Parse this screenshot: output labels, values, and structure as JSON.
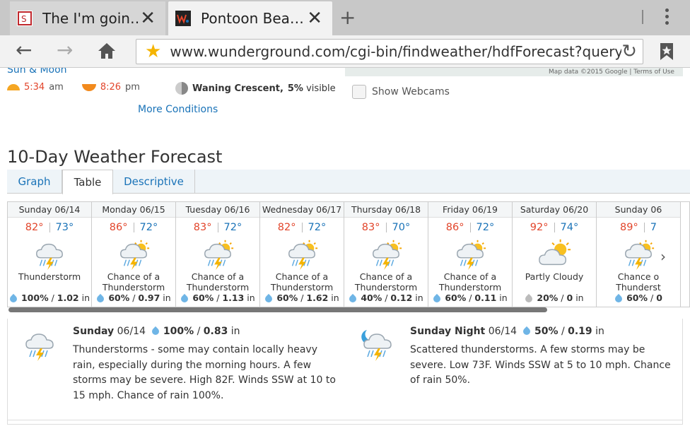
{
  "browser": {
    "tabs": [
      {
        "title": "The I'm goin…",
        "favicon": "site-favicon",
        "close": "✕"
      },
      {
        "title": "Pontoon Bea…",
        "favicon": "wunderground-favicon",
        "close": "✕"
      }
    ],
    "new_tab": "+",
    "url": "www.wunderground.com/cgi-bin/findweather/hdfForecast?query=po"
  },
  "page": {
    "sun_moon_label": "Sun & Moon",
    "sunrise": "5:34",
    "sunrise_suffix": "am",
    "sunset": "8:26",
    "sunset_suffix": "pm",
    "moon_phase": "Waning Crescent,",
    "moon_pct": "5%",
    "moon_suffix": "visible",
    "map_credit": "Map data ©2015 Google  |  Terms of Use",
    "webcams_label": "Show Webcams",
    "more_conditions": "More Conditions",
    "forecast_title": "10-Day Weather Forecast",
    "tabs": [
      "Graph",
      "Table",
      "Descriptive"
    ],
    "days": [
      {
        "name": "Sunday 06/14",
        "hi": "82°",
        "lo": "73°",
        "cond1": "Thunderstorm",
        "cond2": "",
        "pct": "100%",
        "amt": "1.02",
        "unit": "in",
        "icon": "thunderstorm-icon"
      },
      {
        "name": "Monday 06/15",
        "hi": "86°",
        "lo": "72°",
        "cond1": "Chance of a",
        "cond2": "Thunderstorm",
        "pct": "60%",
        "amt": "0.97",
        "unit": "in",
        "icon": "chance-tstorm-icon"
      },
      {
        "name": "Tuesday 06/16",
        "hi": "83°",
        "lo": "72°",
        "cond1": "Chance of a",
        "cond2": "Thunderstorm",
        "pct": "60%",
        "amt": "1.13",
        "unit": "in",
        "icon": "chance-tstorm-icon"
      },
      {
        "name": "Wednesday 06/17",
        "hi": "82°",
        "lo": "72°",
        "cond1": "Chance of a",
        "cond2": "Thunderstorm",
        "pct": "60%",
        "amt": "1.62",
        "unit": "in",
        "icon": "chance-tstorm-icon"
      },
      {
        "name": "Thursday 06/18",
        "hi": "83°",
        "lo": "70°",
        "cond1": "Chance of a",
        "cond2": "Thunderstorm",
        "pct": "40%",
        "amt": "0.12",
        "unit": "in",
        "icon": "chance-tstorm-icon"
      },
      {
        "name": "Friday 06/19",
        "hi": "86°",
        "lo": "72°",
        "cond1": "Chance of a",
        "cond2": "Thunderstorm",
        "pct": "60%",
        "amt": "0.11",
        "unit": "in",
        "icon": "chance-tstorm-icon"
      },
      {
        "name": "Saturday 06/20",
        "hi": "92°",
        "lo": "74°",
        "cond1": "Partly Cloudy",
        "cond2": "",
        "pct": "20%",
        "amt": "0",
        "unit": "in",
        "icon": "partly-cloudy-icon"
      },
      {
        "name": "Sunday 06",
        "hi": "89°",
        "lo": "7",
        "cond1": "Chance o",
        "cond2": "Thunderst",
        "pct": "60%",
        "amt": "0",
        "unit": "",
        "icon": "chance-tstorm-icon"
      }
    ],
    "details": [
      {
        "day": "Sunday",
        "date": "06/14",
        "pct": "100%",
        "amt": "0.83",
        "unit": "in",
        "text": "Thunderstorms - some may contain locally heavy rain, especially during the morning hours. A few storms may be severe. High 82F. Winds SSW at 10 to 15 mph. Chance of rain 100%.",
        "icon": "thunderstorm-icon"
      },
      {
        "day": "Sunday Night",
        "date": "06/14",
        "pct": "50%",
        "amt": "0.19",
        "unit": "in",
        "text": "Scattered thunderstorms. A few storms may be severe. Low 73F. Winds SSW at 5 to 10 mph. Chance of rain 50%.",
        "icon": "night-tstorm-icon"
      }
    ]
  }
}
